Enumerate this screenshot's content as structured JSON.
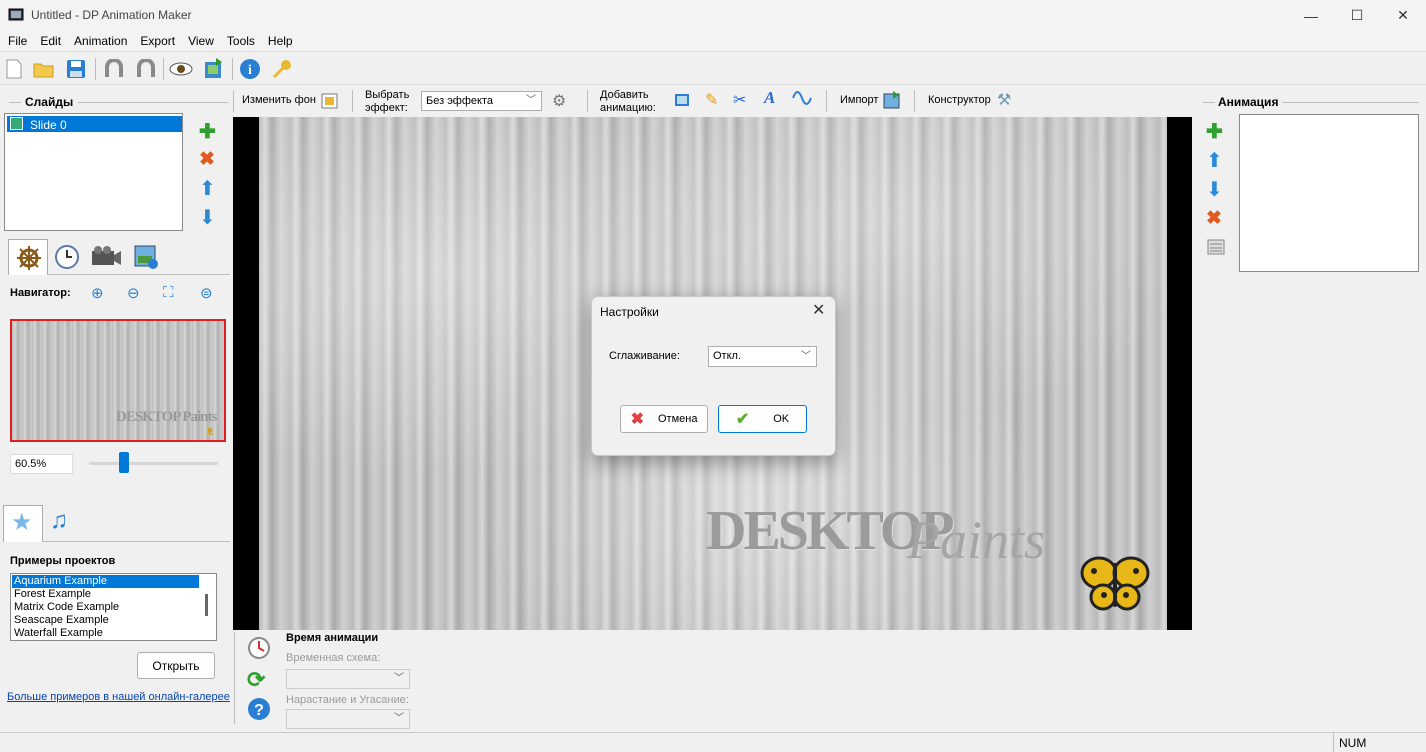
{
  "window": {
    "title": "Untitled - DP Animation Maker"
  },
  "menu": [
    "File",
    "Edit",
    "Animation",
    "Export",
    "View",
    "Tools",
    "Help"
  ],
  "toolbar_icons": [
    "new-file-icon",
    "open-folder-icon",
    "save-icon",
    "undo-icon",
    "redo-icon",
    "preview-eye-icon",
    "export-film-icon",
    "info-icon",
    "key-icon"
  ],
  "slides": {
    "header": "Слайды",
    "items": [
      "Slide 0"
    ]
  },
  "editbar": {
    "change_bg": "Изменить фон",
    "choose_effect": "Выбрать\nэффект:",
    "effect_value": "Без эффекта",
    "add_animation": "Добавить\nанимацию:",
    "import": "Импорт",
    "constructor": "Конструктор"
  },
  "navigator": {
    "label": "Навигатор:",
    "zoom": "60.5%",
    "zoom_fraction": 0.25
  },
  "examples": {
    "header": "Примеры проектов",
    "items": [
      "Aquarium Example",
      "Forest Example",
      "Matrix Code Example",
      "Seascape Example",
      "Waterfall Example"
    ],
    "open_button": "Открыть",
    "gallery_link": "Больше примеров в нашей онлайн-галерее"
  },
  "animation_panel": {
    "header": "Анимация"
  },
  "timing": {
    "header": "Время анимации",
    "scheme_label": "Временная схема:",
    "fade_label": "Нарастание и Угасание:"
  },
  "canvas": {
    "watermark_bold": "DESKTOP",
    "watermark_script": "Paints",
    "thumb_watermark": "DESKTOP Paints"
  },
  "dialog": {
    "title": "Настройки",
    "smoothing_label": "Сглаживание:",
    "smoothing_value": "Откл.",
    "cancel": "Отмена",
    "ok": "OK"
  },
  "status": {
    "num": "NUM"
  },
  "colors": {
    "selection": "#0078d7",
    "red_border": "#e02020",
    "green": "#2da02d",
    "blue": "#2a8ad8",
    "orange": "#e05a20"
  }
}
